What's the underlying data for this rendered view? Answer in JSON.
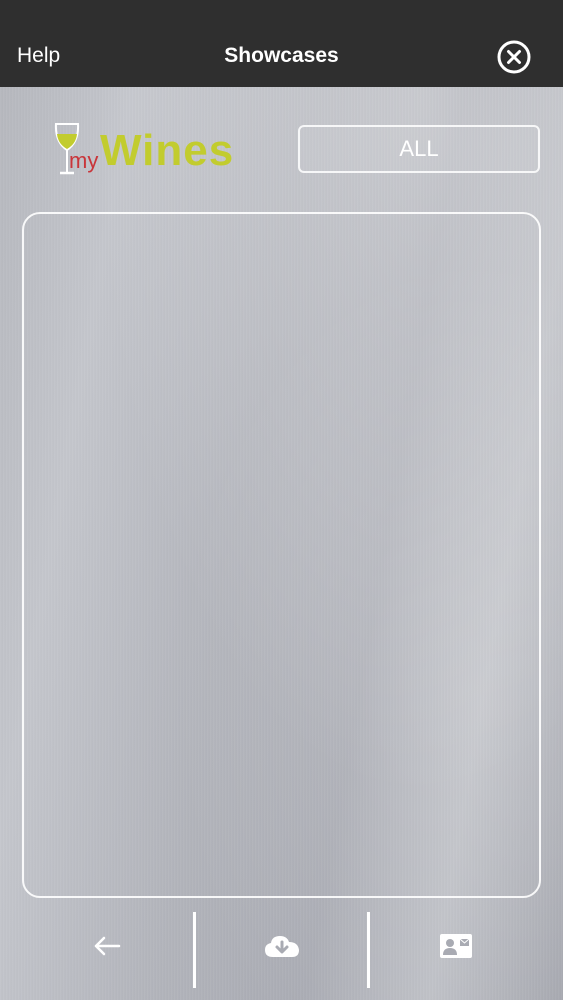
{
  "navbar": {
    "left_label": "Help",
    "title": "Showcases",
    "right_icon": "close-circle-icon",
    "background_color": "#2f2f2f"
  },
  "logo": {
    "prefix": "my",
    "name": "Wines",
    "prefix_color": "#c9353a",
    "name_color": "#c2cc2e"
  },
  "filter": {
    "label": "ALL"
  },
  "showcase_panel": {
    "items": []
  },
  "toolbar": {
    "items": [
      {
        "icon": "arrow-left-icon"
      },
      {
        "icon": "cloud-download-icon"
      },
      {
        "icon": "contact-card-icon"
      }
    ]
  }
}
